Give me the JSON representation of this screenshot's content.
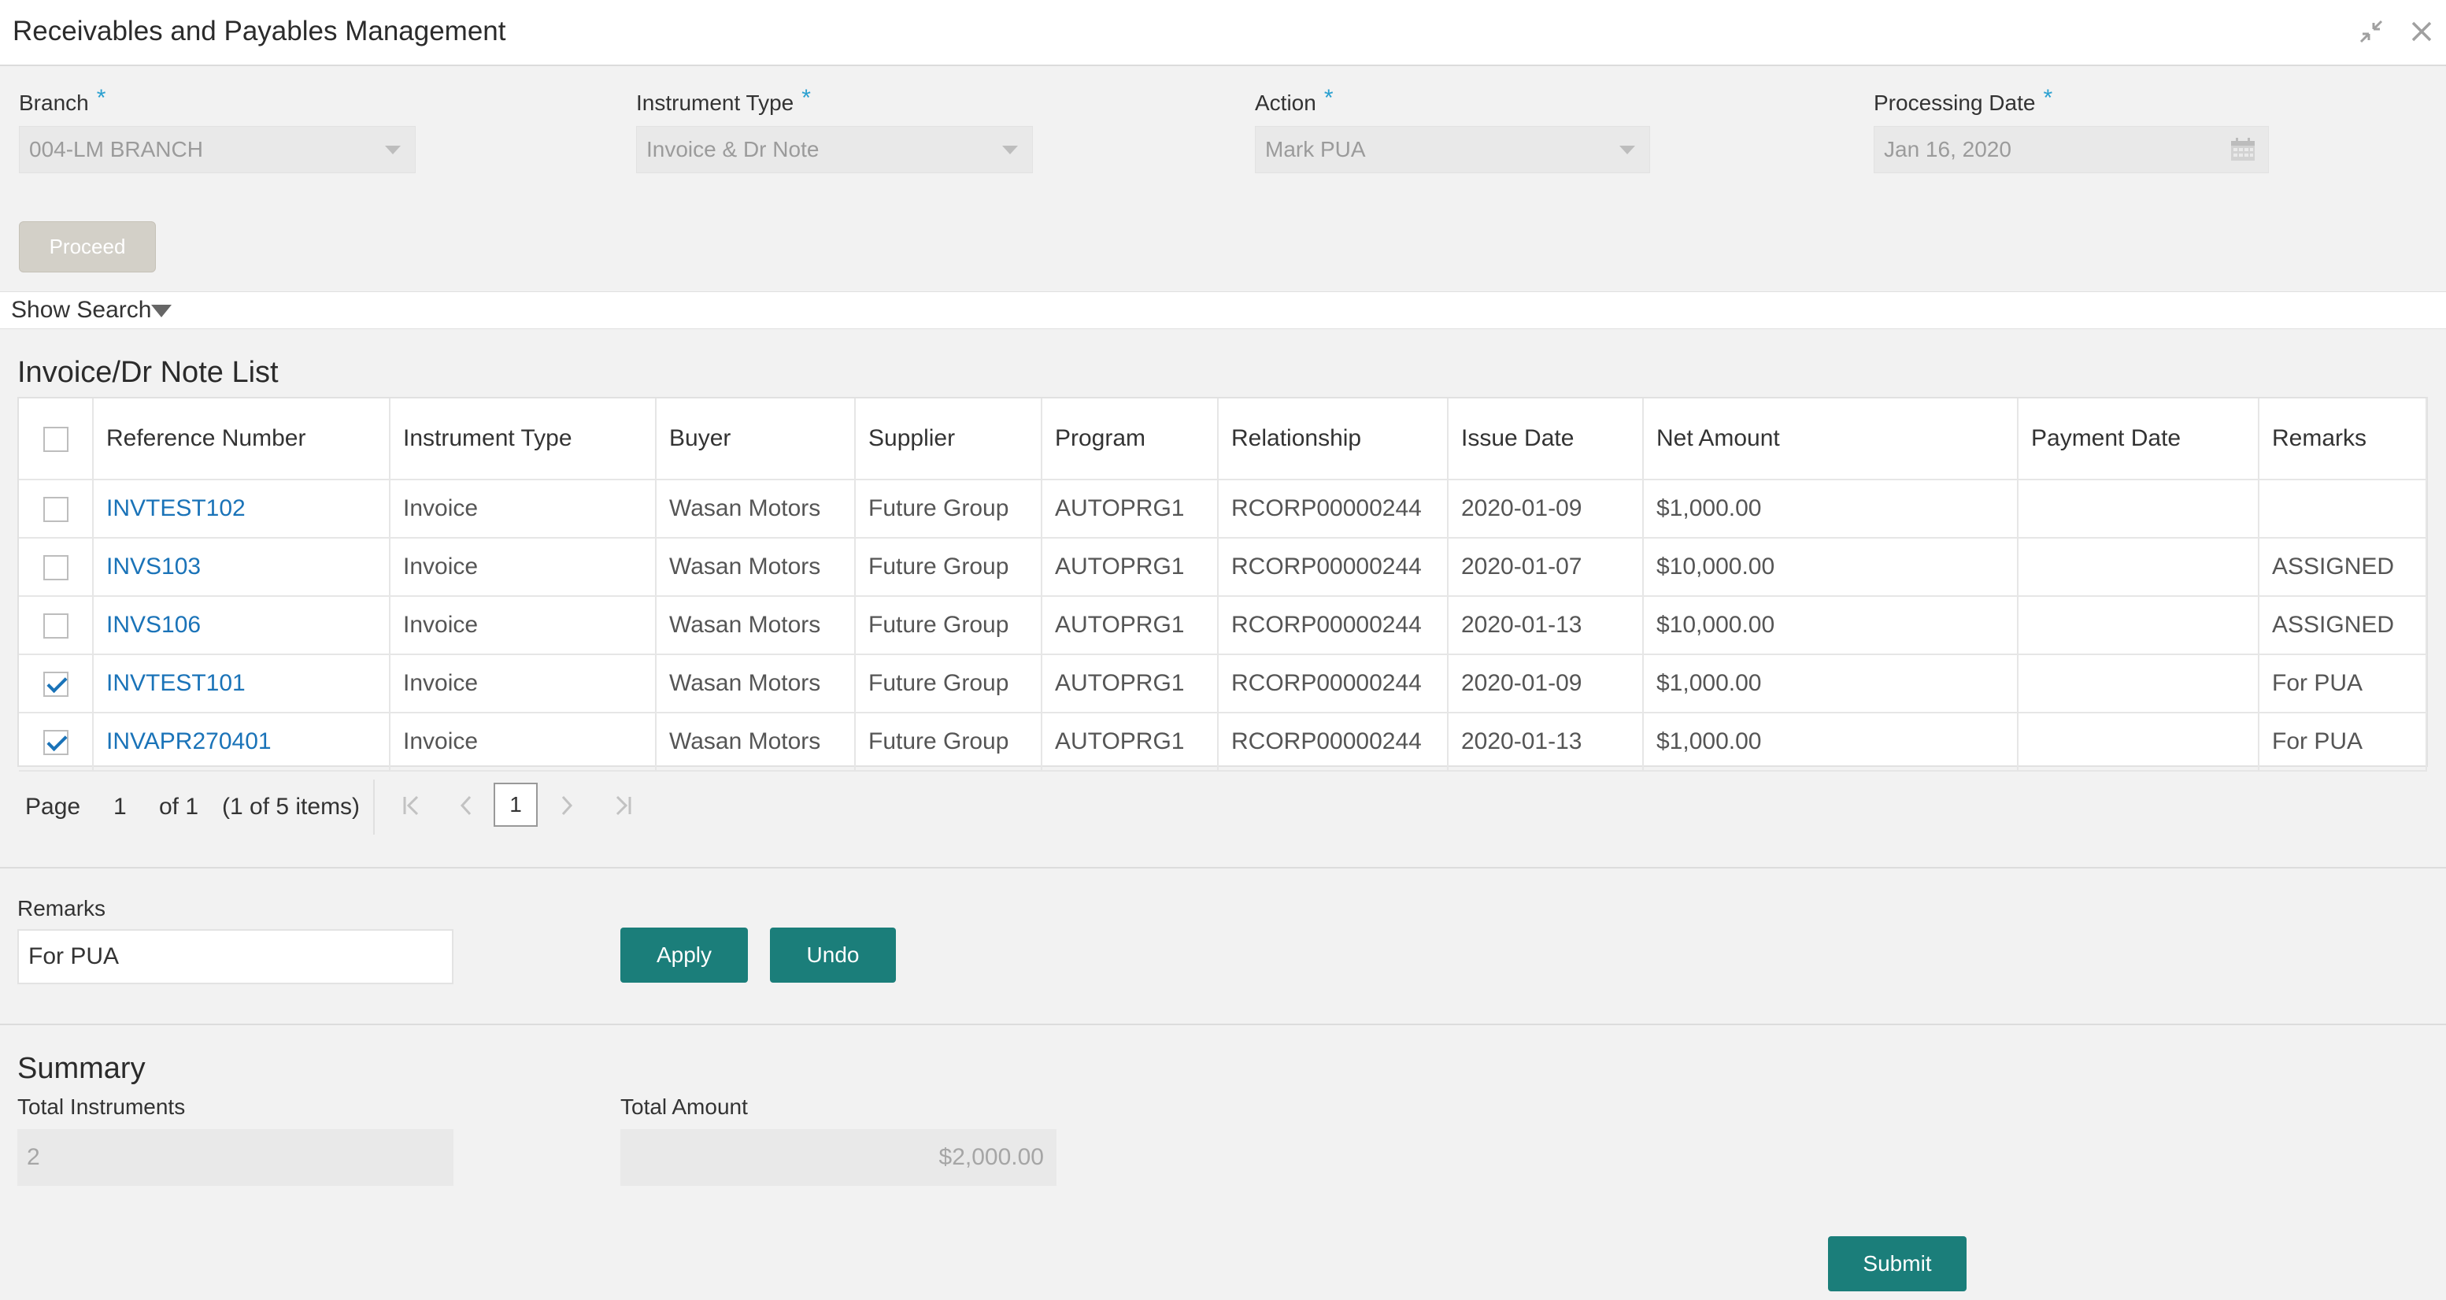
{
  "header": {
    "title": "Receivables and Payables Management"
  },
  "form": {
    "branch_label": "Branch",
    "branch_value": "004-LM BRANCH",
    "instrument_type_label": "Instrument Type",
    "instrument_type_value": "Invoice & Dr Note",
    "action_label": "Action",
    "action_value": "Mark PUA",
    "processing_date_label": "Processing Date",
    "processing_date_value": "Jan 16, 2020",
    "required_mark": "*",
    "proceed_label": "Proceed"
  },
  "search": {
    "toggle_label": "Show Search"
  },
  "list": {
    "title": "Invoice/Dr Note List",
    "columns": [
      "Reference Number",
      "Instrument Type",
      "Buyer",
      "Supplier",
      "Program",
      "Relationship",
      "Issue Date",
      "Net Amount",
      "Payment Date",
      "Remarks"
    ],
    "rows": [
      {
        "checked": false,
        "ref": "INVTEST102",
        "type": "Invoice",
        "buyer": "Wasan Motors",
        "supplier": "Future Group",
        "program": "AUTOPRG1",
        "relationship": "RCORP00000244",
        "issue_date": "2020-01-09",
        "net_amount": "$1,000.00",
        "payment_date": "",
        "remarks": ""
      },
      {
        "checked": false,
        "ref": "INVS103",
        "type": "Invoice",
        "buyer": "Wasan Motors",
        "supplier": "Future Group",
        "program": "AUTOPRG1",
        "relationship": "RCORP00000244",
        "issue_date": "2020-01-07",
        "net_amount": "$10,000.00",
        "payment_date": "",
        "remarks": "ASSIGNED"
      },
      {
        "checked": false,
        "ref": "INVS106",
        "type": "Invoice",
        "buyer": "Wasan Motors",
        "supplier": "Future Group",
        "program": "AUTOPRG1",
        "relationship": "RCORP00000244",
        "issue_date": "2020-01-13",
        "net_amount": "$10,000.00",
        "payment_date": "",
        "remarks": "ASSIGNED"
      },
      {
        "checked": true,
        "ref": "INVTEST101",
        "type": "Invoice",
        "buyer": "Wasan Motors",
        "supplier": "Future Group",
        "program": "AUTOPRG1",
        "relationship": "RCORP00000244",
        "issue_date": "2020-01-09",
        "net_amount": "$1,000.00",
        "payment_date": "",
        "remarks": "For PUA"
      },
      {
        "checked": true,
        "ref": "INVAPR270401",
        "type": "Invoice",
        "buyer": "Wasan Motors",
        "supplier": "Future Group",
        "program": "AUTOPRG1",
        "relationship": "RCORP00000244",
        "issue_date": "2020-01-13",
        "net_amount": "$1,000.00",
        "payment_date": "",
        "remarks": "For PUA"
      }
    ]
  },
  "pager": {
    "page_label": "Page",
    "page_number": "1",
    "of_label": "of 1",
    "items_label": "(1 of 5 items)",
    "current": "1"
  },
  "remarks": {
    "label": "Remarks",
    "value": "For PUA",
    "apply_label": "Apply",
    "undo_label": "Undo"
  },
  "summary": {
    "title": "Summary",
    "total_instruments_label": "Total Instruments",
    "total_instruments_value": "2",
    "total_amount_label": "Total Amount",
    "total_amount_value": "$2,000.00",
    "submit_label": "Submit"
  },
  "colors": {
    "accent_teal": "#1b7e7a",
    "link_blue": "#1a73b8",
    "required_blue": "#2aa0d0"
  }
}
